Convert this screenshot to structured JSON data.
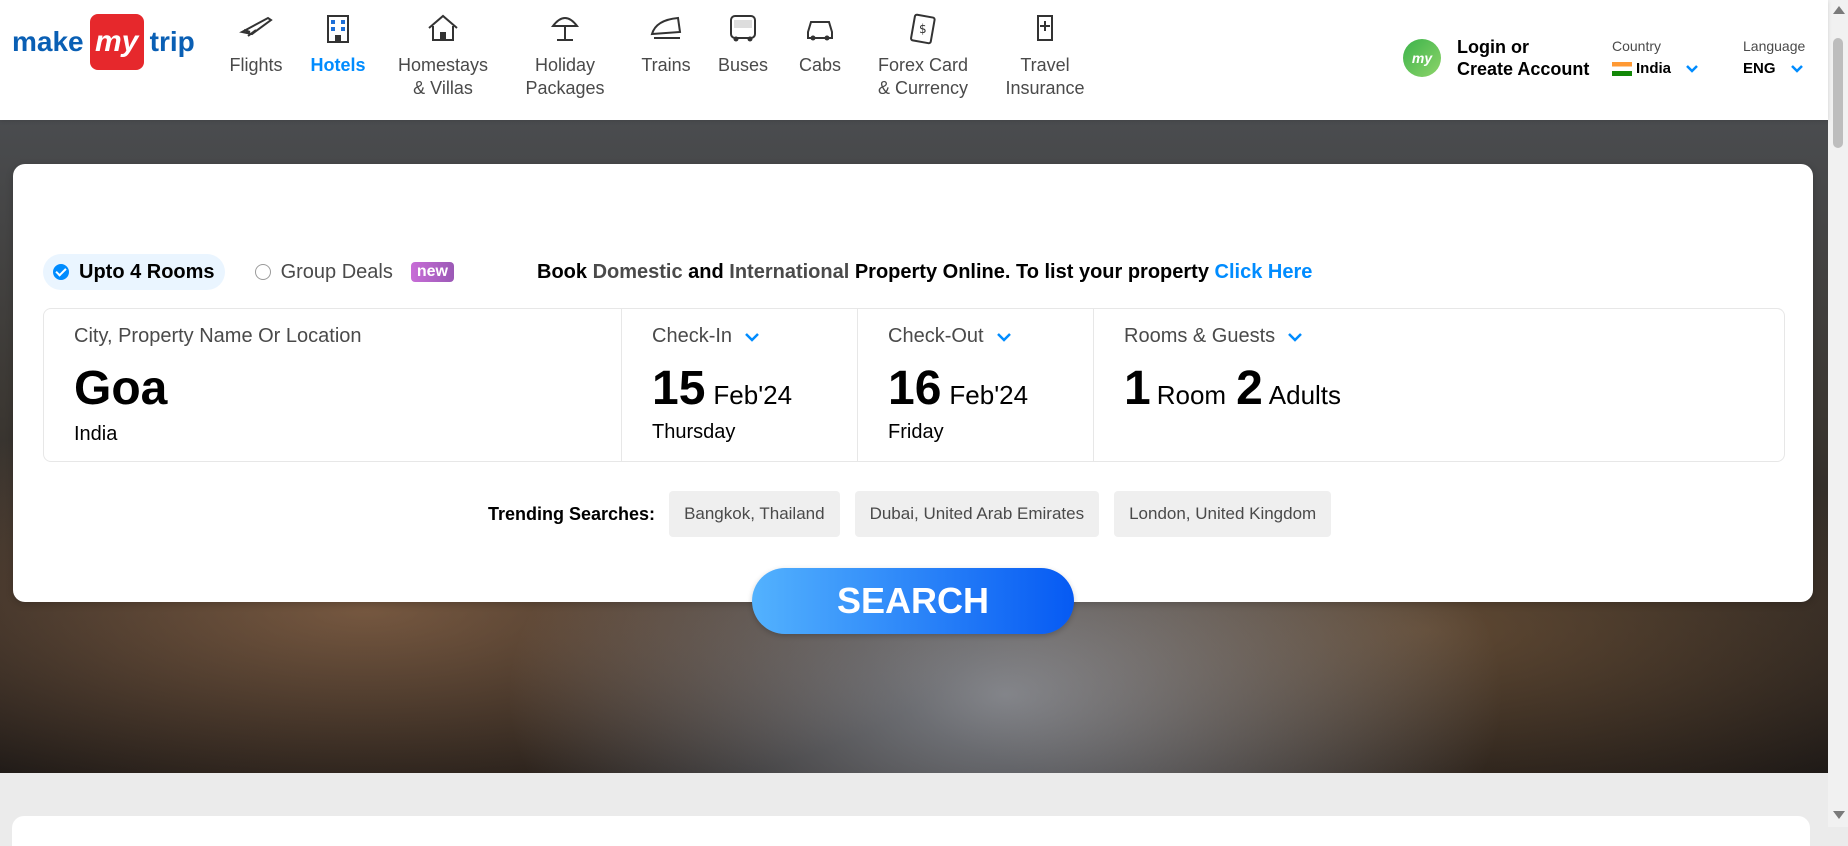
{
  "header": {
    "logo": {
      "make": "make",
      "my": "my",
      "trip": "trip"
    },
    "nav": [
      {
        "label_1": "Flights",
        "label_2": "",
        "icon": "plane-icon",
        "active": false
      },
      {
        "label_1": "Hotels",
        "label_2": "",
        "icon": "hotel-building-icon",
        "active": true
      },
      {
        "label_1": "Homestays",
        "label_2": "& Villas",
        "icon": "house-icon",
        "active": false
      },
      {
        "label_1": "Holiday",
        "label_2": "Packages",
        "icon": "umbrella-icon",
        "active": false
      },
      {
        "label_1": "Trains",
        "label_2": "",
        "icon": "train-icon",
        "active": false
      },
      {
        "label_1": "Buses",
        "label_2": "",
        "icon": "bus-icon",
        "active": false
      },
      {
        "label_1": "Cabs",
        "label_2": "",
        "icon": "cab-icon",
        "active": false
      },
      {
        "label_1": "Forex Card",
        "label_2": "& Currency",
        "icon": "forex-card-icon",
        "active": false
      },
      {
        "label_1": "Travel",
        "label_2": "Insurance",
        "icon": "insurance-icon",
        "active": false
      }
    ],
    "account": {
      "avatar_text": "my",
      "line1": "Login or",
      "line2": "Create Account"
    },
    "country": {
      "label": "Country",
      "value": "India"
    },
    "language": {
      "label": "Language",
      "value": "ENG"
    }
  },
  "search": {
    "options": {
      "upto_rooms": "Upto 4 Rooms",
      "group_deals": "Group Deals",
      "new_badge": "new"
    },
    "promo": {
      "p1": "Book ",
      "p2": "Domestic",
      "p3": " and ",
      "p4": "International",
      "p5": " Property Online. To list your property ",
      "link": "Click Here"
    },
    "city": {
      "label": "City, Property Name Or Location",
      "value": "Goa",
      "sub": "India"
    },
    "checkin": {
      "label": "Check-In",
      "day": "15",
      "month": "Feb'24",
      "weekday": "Thursday"
    },
    "checkout": {
      "label": "Check-Out",
      "day": "16",
      "month": "Feb'24",
      "weekday": "Friday"
    },
    "guests": {
      "label": "Rooms & Guests",
      "rooms_num": "1",
      "rooms_txt": "Room",
      "adults_num": "2",
      "adults_txt": "Adults"
    },
    "trending": {
      "label": "Trending Searches:",
      "items": [
        "Bangkok, Thailand",
        "Dubai, United Arab Emirates",
        "London, United Kingdom"
      ]
    },
    "button": "SEARCH"
  },
  "colors": {
    "accent": "#008cff",
    "brand_red": "#e6282c",
    "brand_blue": "#0a5fb4"
  }
}
